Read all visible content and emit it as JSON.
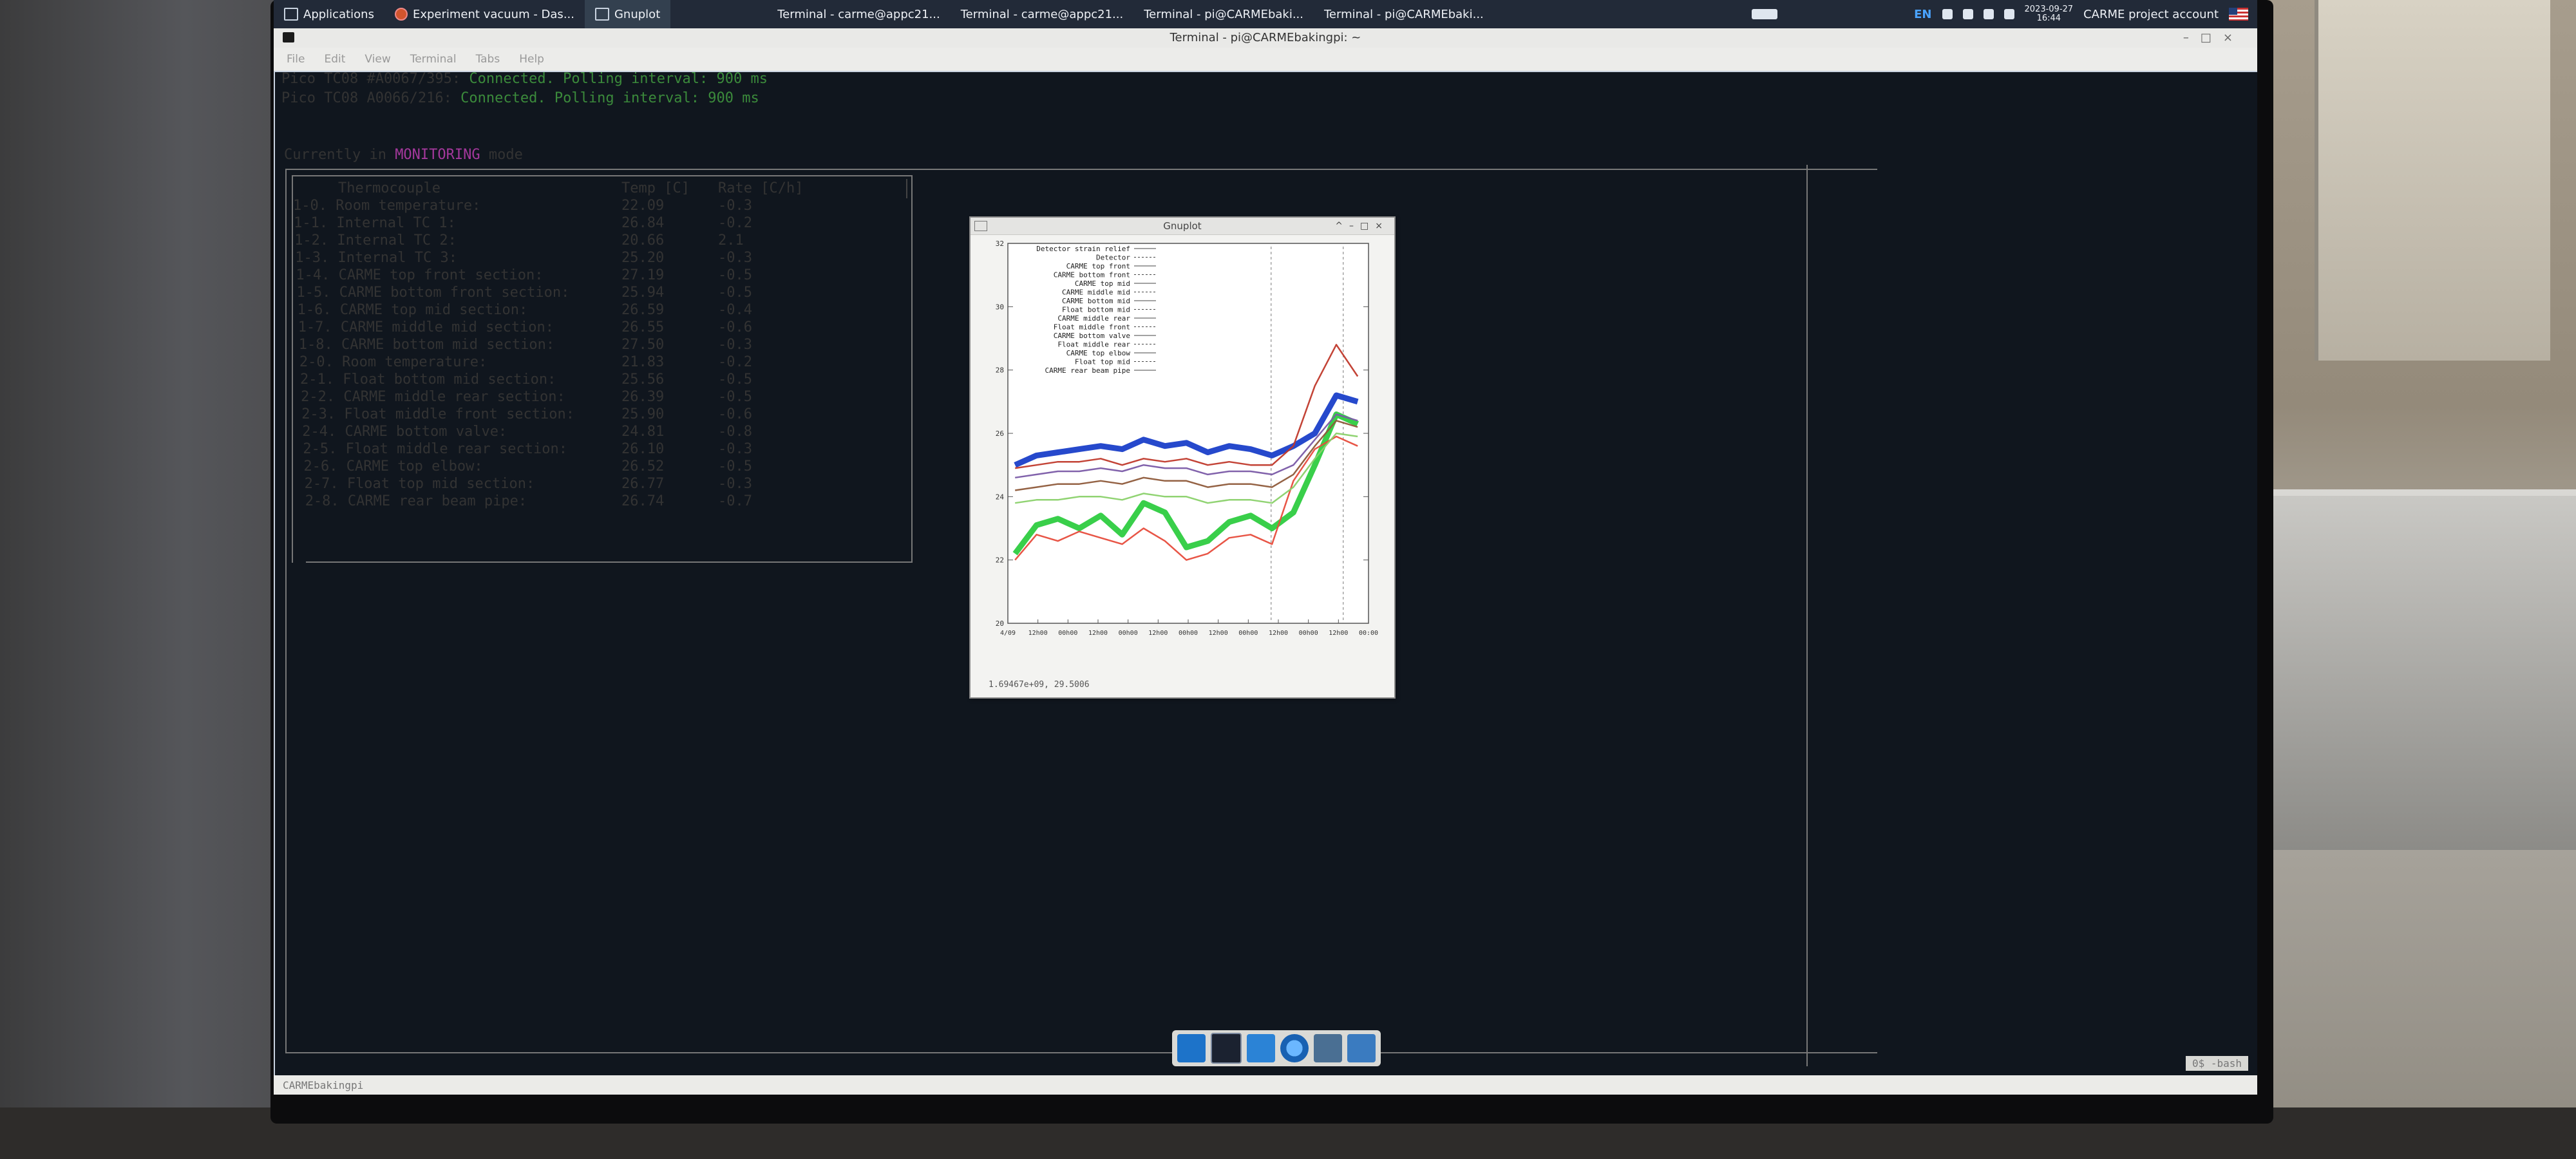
{
  "panel": {
    "apps_label": "Applications",
    "task_browser": "Experiment vacuum - Das...",
    "task_gnuplot": "Gnuplot",
    "task_term1": "Terminal - carme@appc21...",
    "task_term2": "Terminal - carme@appc21...",
    "task_term3": "Terminal - pi@CARMEbaki...",
    "task_term4": "Terminal - pi@CARMEbaki...",
    "lang": "EN",
    "date": "2023-09-27",
    "time": "16:44",
    "account": "CARME project account"
  },
  "terminal": {
    "title": "Terminal - pi@CARMEbakingpi: ~",
    "menu": [
      "File",
      "Edit",
      "View",
      "Terminal",
      "Tabs",
      "Help"
    ],
    "status_lines": [
      {
        "prefix": "Pico TC08 #A0067/395: ",
        "status": "Connected. Polling interval: 900 ms"
      },
      {
        "prefix": "Pico TC08 A0066/216: ",
        "status": "Connected. Polling interval: 900 ms"
      }
    ],
    "mode_prefix": "Currently in ",
    "mode": "MONITORING",
    "mode_suffix": " mode",
    "table": {
      "headers": {
        "name": "Thermocouple",
        "temp": "Temp [C]",
        "rate": "Rate [C/h]"
      },
      "rows": [
        {
          "name": "1-0. Room temperature:",
          "temp": "22.09",
          "rate": "-0.3"
        },
        {
          "name": "1-1. Internal TC 1:",
          "temp": "26.84",
          "rate": "-0.2"
        },
        {
          "name": "1-2. Internal TC 2:",
          "temp": "20.66",
          "rate": "2.1"
        },
        {
          "name": "1-3. Internal TC 3:",
          "temp": "25.20",
          "rate": "-0.3"
        },
        {
          "name": "1-4. CARME top front section:",
          "temp": "27.19",
          "rate": "-0.5"
        },
        {
          "name": "1-5. CARME bottom front section:",
          "temp": "25.94",
          "rate": "-0.5"
        },
        {
          "name": "1-6. CARME top mid section:",
          "temp": "26.59",
          "rate": "-0.4"
        },
        {
          "name": "1-7. CARME middle mid section:",
          "temp": "26.55",
          "rate": "-0.6"
        },
        {
          "name": "1-8. CARME bottom mid section:",
          "temp": "27.50",
          "rate": "-0.3"
        },
        {
          "name": "2-0. Room temperature:",
          "temp": "21.83",
          "rate": "-0.2"
        },
        {
          "name": "2-1. Float bottom mid section:",
          "temp": "25.56",
          "rate": "-0.5"
        },
        {
          "name": "2-2. CARME middle rear section:",
          "temp": "26.39",
          "rate": "-0.5"
        },
        {
          "name": "2-3. Float middle front section:",
          "temp": "25.90",
          "rate": "-0.6"
        },
        {
          "name": "2-4. CARME bottom valve:",
          "temp": "24.81",
          "rate": "-0.8"
        },
        {
          "name": "2-5. Float middle rear section:",
          "temp": "26.10",
          "rate": "-0.3"
        },
        {
          "name": "2-6. CARME top elbow:",
          "temp": "26.52",
          "rate": "-0.5"
        },
        {
          "name": "2-7. Float top mid section:",
          "temp": "26.77",
          "rate": "-0.3"
        },
        {
          "name": "2-8. CARME rear beam pipe:",
          "temp": "26.74",
          "rate": "-0.7"
        }
      ]
    },
    "statusbar_left": "CARMEbakingpi",
    "statusbar_right": "0$ -bash"
  },
  "gnuplot": {
    "title": "Gnuplot",
    "status": "1.69467e+09, 29.5006",
    "legend": [
      "Detector strain relief",
      "Detector",
      "CARME top front",
      "CARME bottom front",
      "CARME top mid",
      "CARME middle mid",
      "CARME bottom mid",
      "Float bottom mid",
      "CARME middle rear",
      "Float middle front",
      "CARME bottom valve",
      "Float middle rear",
      "CARME top elbow",
      "Float top mid",
      "CARME rear beam pipe"
    ],
    "y_ticks": [
      "32",
      "30",
      "28",
      "26",
      "24",
      "22",
      "20"
    ],
    "x_ticks": [
      "4/09",
      "12h00",
      "00h00",
      "12h00",
      "00h00",
      "12h00",
      "00h00",
      "12h00",
      "00h00",
      "12h00",
      "00h00",
      "12h00",
      "00:00"
    ]
  },
  "chart_data": {
    "type": "line",
    "title": "",
    "xlabel": "",
    "ylabel": "",
    "ylim": [
      20,
      32
    ],
    "x": [
      0,
      1,
      2,
      3,
      4,
      5,
      6,
      7,
      8,
      9,
      10,
      11,
      12,
      13,
      14,
      15,
      16
    ],
    "series": [
      {
        "name": "CARME top front",
        "color": "#1a3fc9",
        "values": [
          25.0,
          25.3,
          25.4,
          25.5,
          25.6,
          25.5,
          25.8,
          25.6,
          25.7,
          25.4,
          25.6,
          25.5,
          25.3,
          25.6,
          26.0,
          27.2,
          27.0
        ]
      },
      {
        "name": "Detector strain relief",
        "color": "#c0392b",
        "values": [
          24.9,
          25.0,
          25.1,
          25.1,
          25.2,
          25.0,
          25.2,
          25.1,
          25.2,
          25.0,
          25.1,
          25.0,
          25.0,
          25.6,
          27.5,
          28.8,
          27.8
        ]
      },
      {
        "name": "CARME middle mid",
        "color": "#2ecc40",
        "values": [
          22.2,
          23.1,
          23.3,
          23.0,
          23.4,
          22.8,
          23.8,
          23.5,
          22.4,
          22.6,
          23.2,
          23.4,
          23.0,
          23.5,
          25.0,
          26.6,
          26.3
        ]
      },
      {
        "name": "CARME bottom mid",
        "color": "#e74c3c",
        "values": [
          22.0,
          22.8,
          22.6,
          22.9,
          22.7,
          22.5,
          23.0,
          22.6,
          22.0,
          22.2,
          22.7,
          22.8,
          22.5,
          24.5,
          25.5,
          25.9,
          25.6
        ]
      },
      {
        "name": "CARME middle rear",
        "color": "#8e5a3a",
        "values": [
          24.2,
          24.3,
          24.4,
          24.4,
          24.5,
          24.4,
          24.6,
          24.5,
          24.5,
          24.3,
          24.4,
          24.4,
          24.3,
          24.7,
          25.6,
          26.4,
          26.2
        ]
      },
      {
        "name": "Float middle front",
        "color": "#7a5aa6",
        "values": [
          24.6,
          24.7,
          24.8,
          24.8,
          24.9,
          24.8,
          25.0,
          24.9,
          24.9,
          24.7,
          24.8,
          24.8,
          24.7,
          25.0,
          25.8,
          26.6,
          26.4
        ]
      },
      {
        "name": "Float top mid",
        "color": "#8ad16a",
        "values": [
          23.8,
          23.9,
          23.9,
          24.0,
          24.0,
          23.9,
          24.1,
          24.0,
          24.0,
          23.8,
          23.9,
          23.9,
          23.8,
          24.3,
          25.2,
          26.0,
          25.9
        ]
      }
    ]
  }
}
